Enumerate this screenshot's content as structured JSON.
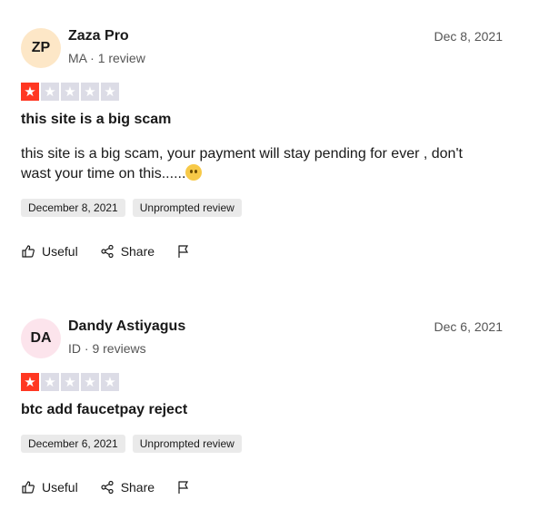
{
  "reviews": [
    {
      "initials": "ZP",
      "avatar_color": "#fde7c7",
      "name": "Zaza Pro",
      "country": "MA",
      "review_count": "1 review",
      "date_short": "Dec 8, 2021",
      "rating": 1,
      "title": "this site is a big scam",
      "body": "this site is a big scam, your payment will stay pending for ever , don't wast your time on this......",
      "body_emoji": "😶",
      "date_long": "December 8, 2021",
      "tag": "Unprompted review",
      "useful_label": "Useful",
      "share_label": "Share"
    },
    {
      "initials": "DA",
      "avatar_color": "#fce4ec",
      "name": "Dandy Astiyagus",
      "country": "ID",
      "review_count": "9 reviews",
      "date_short": "Dec 6, 2021",
      "rating": 1,
      "title": "btc add faucetpay reject",
      "body": "",
      "date_long": "December 6, 2021",
      "tag": "Unprompted review",
      "useful_label": "Useful",
      "share_label": "Share"
    }
  ],
  "colors": {
    "star_active": "#ff3722",
    "star_inactive": "#dcdce6"
  }
}
